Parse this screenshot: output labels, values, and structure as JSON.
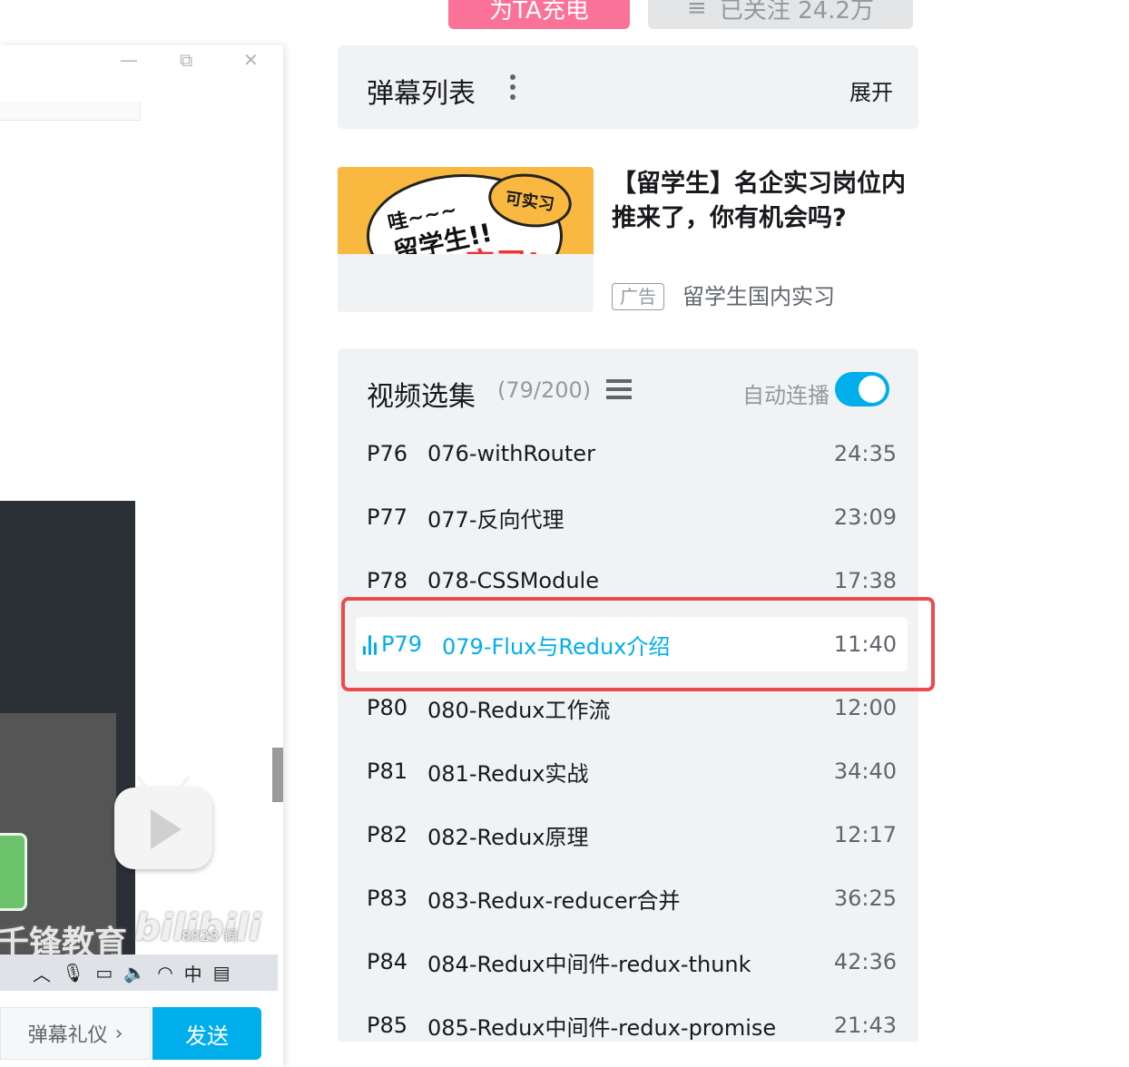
{
  "top_buttons": {
    "charge_label": "为TA充电",
    "follow_icon": "≡",
    "follow_label": "已关注 24.2万"
  },
  "window_controls": {
    "minimize": "—",
    "restore": "⧉",
    "close": "✕"
  },
  "video": {
    "watermark": "千锋教育",
    "logo_text": "bilibili",
    "word_count": "8828 词"
  },
  "taskbar": {
    "items": [
      {
        "name": "chevron-up-icon",
        "glyph": "︿"
      },
      {
        "name": "microphone-icon",
        "glyph": "🎙"
      },
      {
        "name": "battery-icon",
        "glyph": "▭"
      },
      {
        "name": "speaker-icon",
        "glyph": "🔈"
      },
      {
        "name": "wifi-icon",
        "glyph": "◠"
      },
      {
        "name": "ime-indicator",
        "glyph": "中"
      },
      {
        "name": "notification-icon",
        "glyph": "▤"
      }
    ]
  },
  "danmaku_input": {
    "etiquette_label": "弹幕礼仪",
    "etiquette_arrow": "›",
    "send_label": "发送"
  },
  "danmaku_list": {
    "title": "弹幕列表",
    "expand_label": "展开"
  },
  "ad": {
    "bubble_text_1": "哇~~~",
    "bubble_text_2": "留学生!!",
    "stamp_text": "可实习",
    "red_text": "实习!",
    "title": "【留学生】名企实习岗位内推来了，你有机会吗?",
    "badge": "广告",
    "source": "留学生国内实习"
  },
  "episodes": {
    "title": "视频选集",
    "count": "(79/200)",
    "autoplay_label": "自动连播",
    "autoplay_on": true,
    "accent_color": "#00aeec",
    "items": [
      {
        "num": "P76",
        "title": "076-withRouter",
        "duration": "24:35",
        "active": false
      },
      {
        "num": "P77",
        "title": "077-反向代理",
        "duration": "23:09",
        "active": false
      },
      {
        "num": "P78",
        "title": "078-CSSModule",
        "duration": "17:38",
        "active": false
      },
      {
        "num": "P79",
        "title": "079-Flux与Redux介绍",
        "duration": "11:40",
        "active": true
      },
      {
        "num": "P80",
        "title": "080-Redux工作流",
        "duration": "12:00",
        "active": false
      },
      {
        "num": "P81",
        "title": "081-Redux实战",
        "duration": "34:40",
        "active": false
      },
      {
        "num": "P82",
        "title": "082-Redux原理",
        "duration": "12:17",
        "active": false
      },
      {
        "num": "P83",
        "title": "083-Redux-reducer合并",
        "duration": "36:25",
        "active": false
      },
      {
        "num": "P84",
        "title": "084-Redux中间件-redux-thunk",
        "duration": "42:36",
        "active": false
      },
      {
        "num": "P85",
        "title": "085-Redux中间件-redux-promise",
        "duration": "21:43",
        "active": false
      }
    ]
  }
}
